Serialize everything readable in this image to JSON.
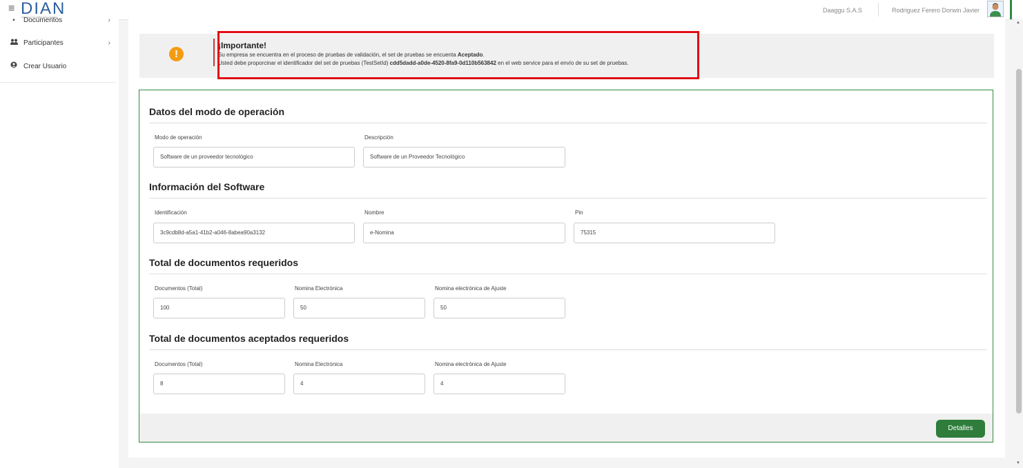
{
  "header": {
    "logo_text": "DIAN",
    "logo_subtitle": "POR UNA COLOMBIA MÁS HONESTA",
    "company": "Daaggu S.A.S",
    "username": "Rodriguez Ferero Dorwin Javier"
  },
  "sidebar": {
    "items": [
      {
        "label": "Documentos",
        "icon": "document-icon"
      },
      {
        "label": "Participantes",
        "icon": "users-icon"
      },
      {
        "label": "Crear Usuario",
        "icon": "user-circle-icon"
      }
    ]
  },
  "alert": {
    "title": "¡Importante!",
    "line1_pre": "Su empresa se encuentra en el proceso de pruebas de validación, el set de pruebas se encuenta ",
    "line1_bold": "Aceptado",
    "line1_post": ".",
    "line2_pre": "Usted debe proporcinar el identificador del set de pruebas (TestSetId) ",
    "line2_bold": "cdd5dadd-a0de-4520-8fa9-0d110b563842",
    "line2_post": " en el web service para el envío de su set de pruebas."
  },
  "sections": {
    "modo": {
      "title": "Datos del modo de operación",
      "label_modo": "Modo de operación",
      "value_modo": "Software de un proveedor tecnológico",
      "label_desc": "Descripción",
      "value_desc": "Software de un Proveedor Tecnológico"
    },
    "software": {
      "title": "Información del Software",
      "label_id": "Identificación",
      "value_id": "3c9cdb8d-a5a1-41b2-a046-8abea90a3132",
      "label_nombre": "Nombre",
      "value_nombre": "e-Nomina",
      "label_pin": "Pin",
      "value_pin": "75315"
    },
    "requeridos": {
      "title": "Total de documentos requeridos",
      "label_total": "Documentos (Total)",
      "value_total": "100",
      "label_nomina": "Nomina Electrónica",
      "value_nomina": "50",
      "label_ajuste": "Nomina electrónica de Ajuste",
      "value_ajuste": "50"
    },
    "aceptados": {
      "title": "Total de documentos aceptados requeridos",
      "label_total": "Documentos (Total)",
      "value_total": "8",
      "label_nomina": "Nomina Electrónica",
      "value_nomina": "4",
      "label_ajuste": "Nomina electrónica de Ajuste",
      "value_ajuste": "4"
    }
  },
  "footer": {
    "detalles_label": "Detalles"
  },
  "colors": {
    "accent_green": "#2e7d3b",
    "alert_orange": "#f39c12",
    "highlight_red": "#e10b14",
    "brand_blue": "#2e5e9e"
  }
}
